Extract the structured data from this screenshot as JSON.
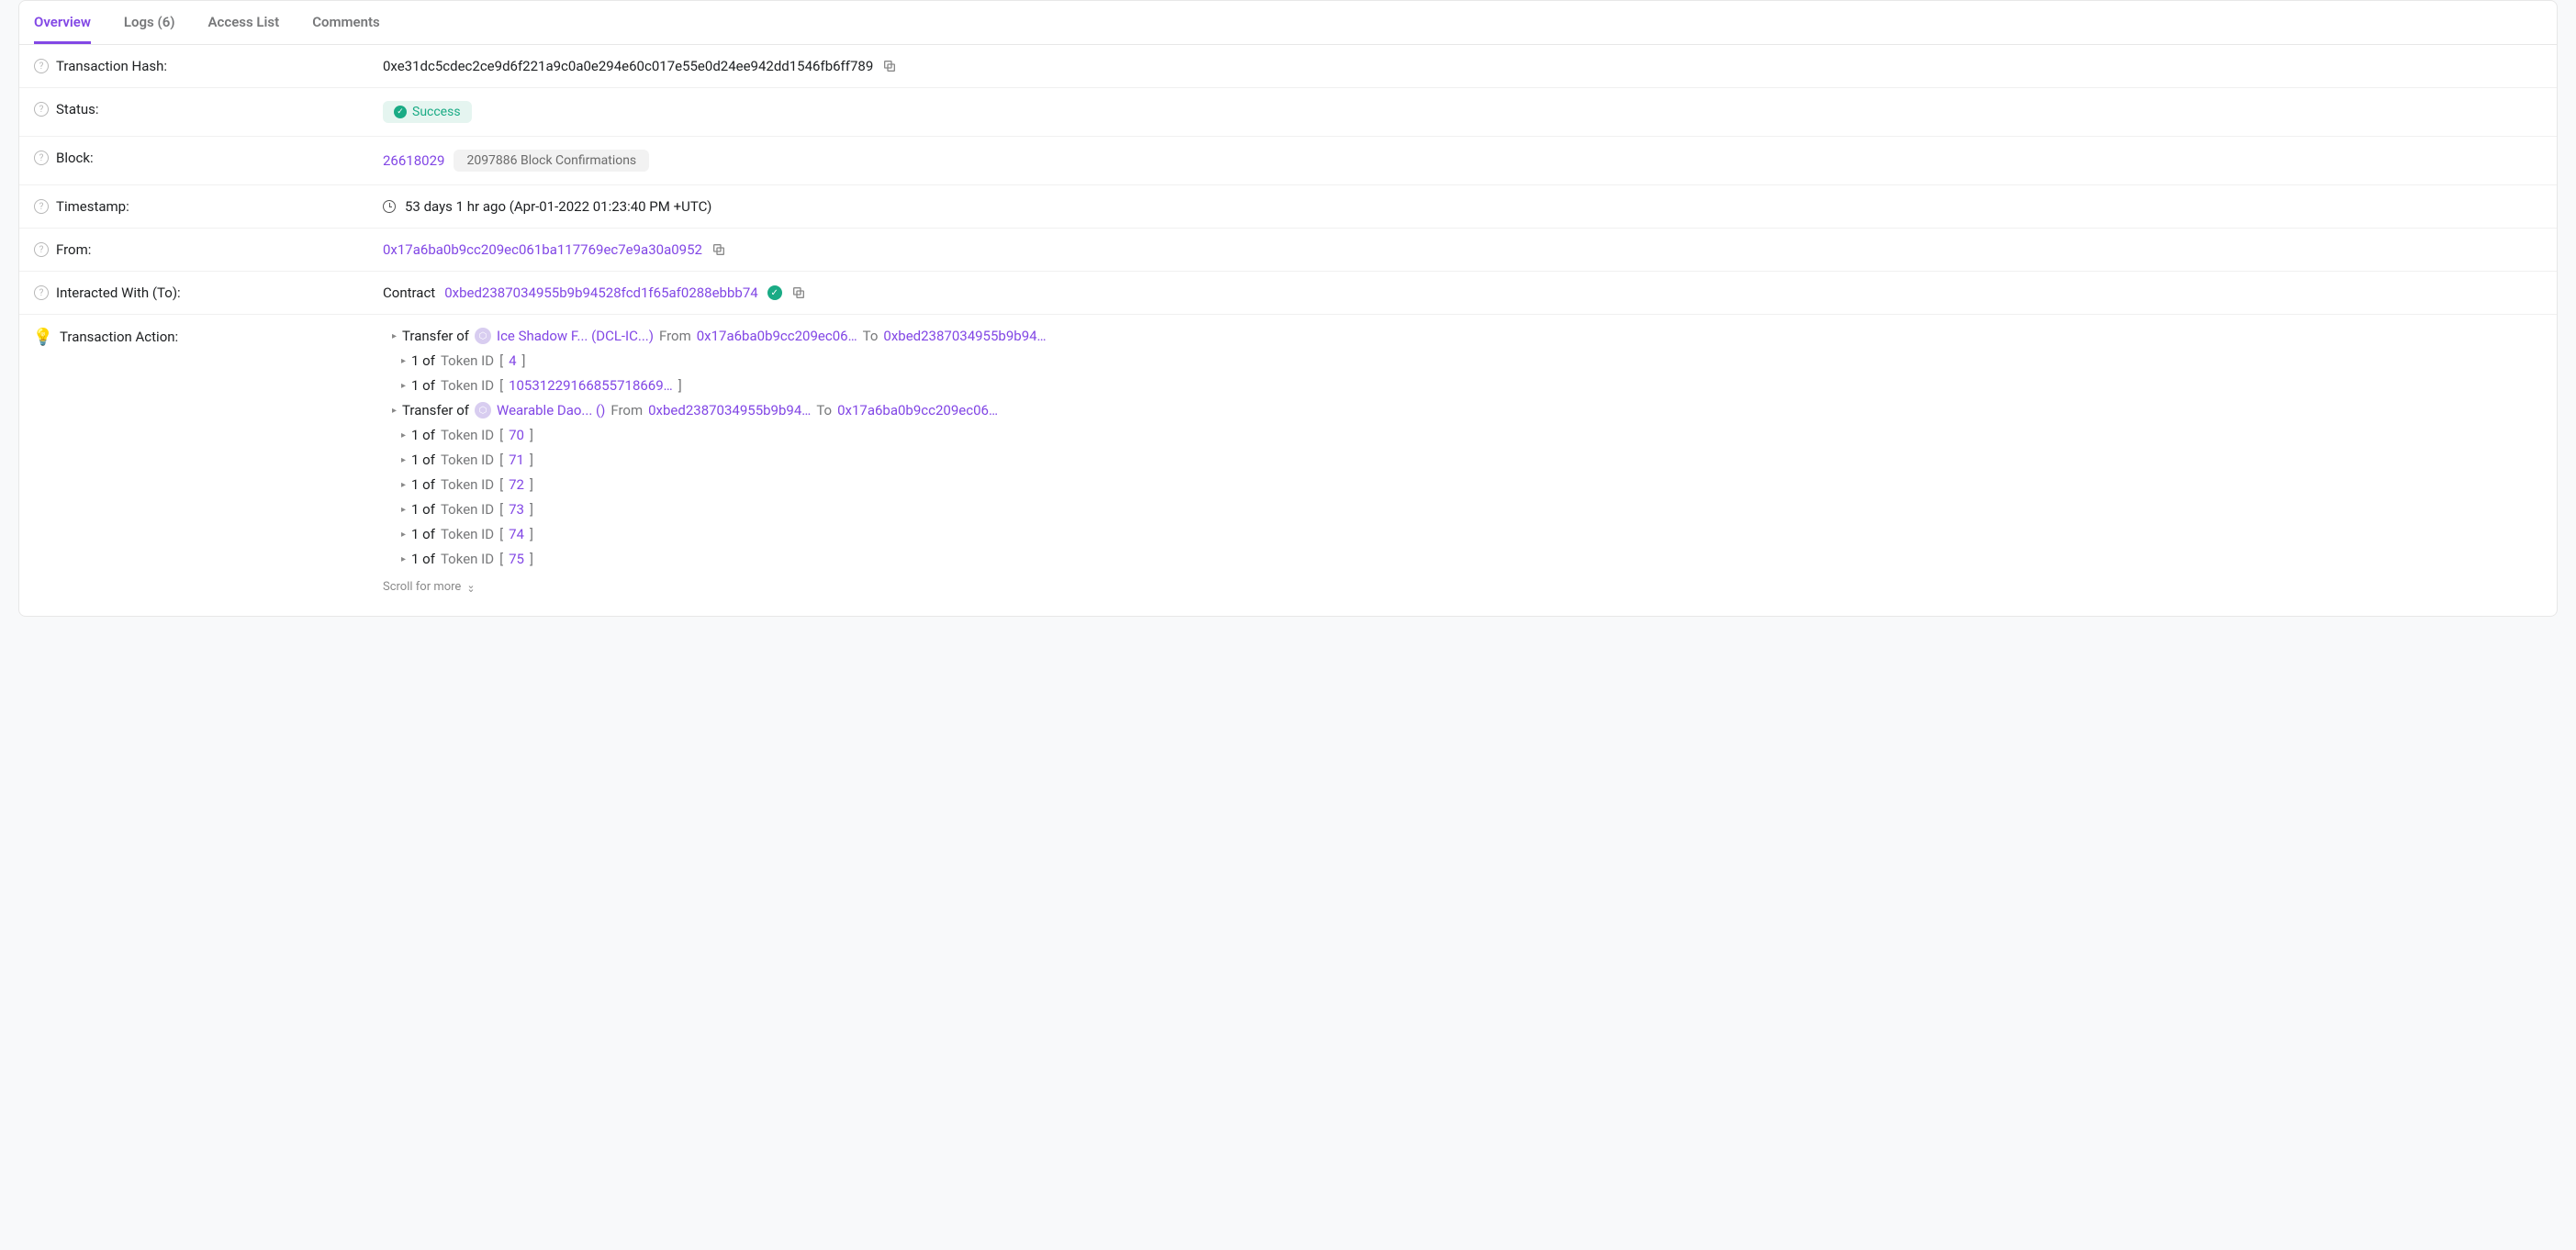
{
  "tabs": {
    "overview": "Overview",
    "logs": "Logs (6)",
    "accessList": "Access List",
    "comments": "Comments"
  },
  "labels": {
    "txHash": "Transaction Hash:",
    "status": "Status:",
    "block": "Block:",
    "timestamp": "Timestamp:",
    "from": "From:",
    "interactedWith": "Interacted With (To):",
    "txAction": "Transaction Action:"
  },
  "values": {
    "txHash": "0xe31dc5cdec2ce9d6f221a9c0a0e294e60c017e55e0d24ee942dd1546fb6ff789",
    "status": "Success",
    "blockNumber": "26618029",
    "confirmations": "2097886 Block Confirmations",
    "timestamp": "53 days 1 hr ago (Apr-01-2022 01:23:40 PM +UTC)",
    "from": "0x17a6ba0b9cc209ec061ba117769ec7e9a30a0952",
    "contractPrefix": "Contract",
    "to": "0xbed2387034955b9b94528fcd1f65af0288ebbb74"
  },
  "actions": {
    "transfer1": {
      "prefix": "Transfer of",
      "tokenName": "Ice Shadow F... (DCL-IC...)",
      "fromLabel": "From",
      "fromAddr": "0x17a6ba0b9cc209ec06…",
      "toLabel": "To",
      "toAddr": "0xbed2387034955b9b94…"
    },
    "transfer2": {
      "prefix": "Transfer of",
      "tokenName": "Wearable Dao... ()",
      "fromLabel": "From",
      "fromAddr": "0xbed2387034955b9b94…",
      "toLabel": "To",
      "toAddr": "0x17a6ba0b9cc209ec06…"
    },
    "tokenIds": {
      "id1": "4",
      "id2": "10531229166855718669…",
      "id70": "70",
      "id71": "71",
      "id72": "72",
      "id73": "73",
      "id74": "74",
      "id75": "75"
    },
    "ofPrefix": "1 of",
    "tokenIdLabel": "Token ID",
    "scrollMore": "Scroll for more"
  }
}
